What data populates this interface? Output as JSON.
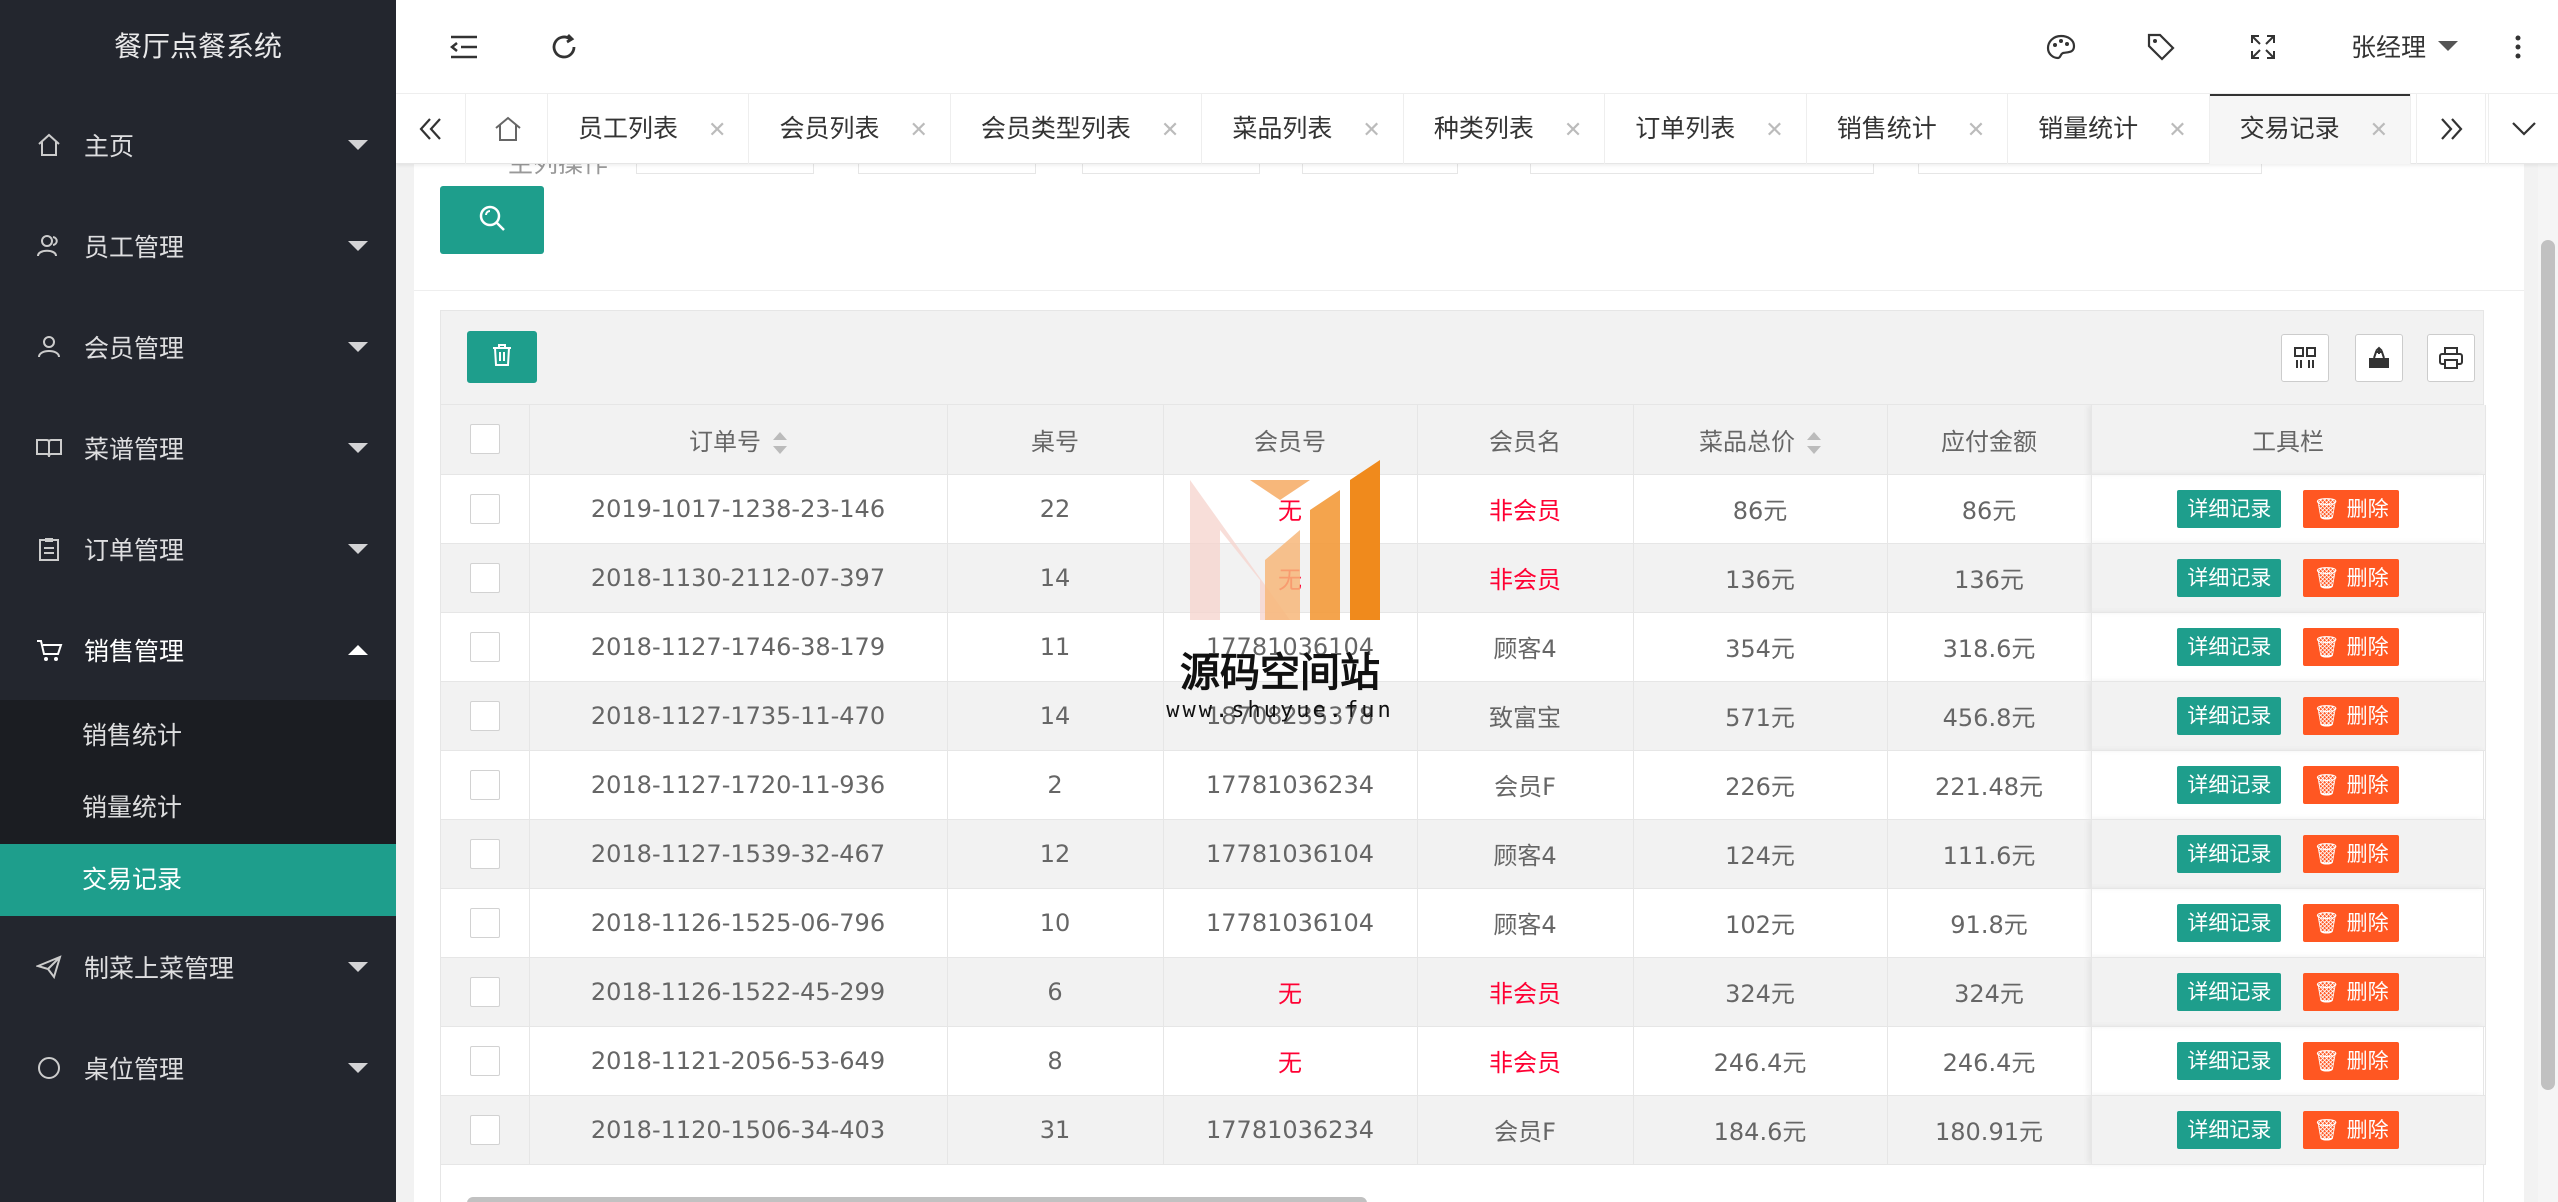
{
  "app_title": "餐厅点餐系统",
  "sidebar": {
    "items": [
      {
        "label": "主页",
        "icon": "home-icon"
      },
      {
        "label": "员工管理",
        "icon": "user-group-icon"
      },
      {
        "label": "会员管理",
        "icon": "user-icon"
      },
      {
        "label": "菜谱管理",
        "icon": "book-icon"
      },
      {
        "label": "订单管理",
        "icon": "clipboard-icon"
      },
      {
        "label": "销售管理",
        "icon": "cart-icon"
      },
      {
        "label": "制菜上菜管理",
        "icon": "send-icon"
      },
      {
        "label": "桌位管理",
        "icon": "circle-icon"
      }
    ],
    "sub_items": [
      "销售统计",
      "销量统计",
      "交易记录"
    ],
    "active_sub": "交易记录"
  },
  "header": {
    "user": "张经理"
  },
  "tabs": [
    "员工列表",
    "会员列表",
    "会员类型列表",
    "菜品列表",
    "种类列表",
    "订单列表",
    "销售统计",
    "销量统计",
    "交易记录"
  ],
  "active_tab": "交易记录",
  "filter_label": "主列操作",
  "table": {
    "columns": [
      "订单号",
      "桌号",
      "会员号",
      "会员名",
      "菜品总价",
      "应付金额",
      "工具栏"
    ],
    "detail_label": "详细记录",
    "delete_label": "删除",
    "rows": [
      {
        "order": "2019-1017-1238-23-146",
        "table": "22",
        "member_no": "无",
        "member_name": "非会员",
        "total": "86元",
        "pay": "86元"
      },
      {
        "order": "2018-1130-2112-07-397",
        "table": "14",
        "member_no": "无",
        "member_name": "非会员",
        "total": "136元",
        "pay": "136元"
      },
      {
        "order": "2018-1127-1746-38-179",
        "table": "11",
        "member_no": "17781036104",
        "member_name": "顾客4",
        "total": "354元",
        "pay": "318.6元"
      },
      {
        "order": "2018-1127-1735-11-470",
        "table": "14",
        "member_no": "18708235378",
        "member_name": "致富宝",
        "total": "571元",
        "pay": "456.8元"
      },
      {
        "order": "2018-1127-1720-11-936",
        "table": "2",
        "member_no": "17781036234",
        "member_name": "会员F",
        "total": "226元",
        "pay": "221.48元"
      },
      {
        "order": "2018-1127-1539-32-467",
        "table": "12",
        "member_no": "17781036104",
        "member_name": "顾客4",
        "total": "124元",
        "pay": "111.6元"
      },
      {
        "order": "2018-1126-1525-06-796",
        "table": "10",
        "member_no": "17781036104",
        "member_name": "顾客4",
        "total": "102元",
        "pay": "91.8元"
      },
      {
        "order": "2018-1126-1522-45-299",
        "table": "6",
        "member_no": "无",
        "member_name": "非会员",
        "total": "324元",
        "pay": "324元"
      },
      {
        "order": "2018-1121-2056-53-649",
        "table": "8",
        "member_no": "无",
        "member_name": "非会员",
        "total": "246.4元",
        "pay": "246.4元"
      },
      {
        "order": "2018-1120-1506-34-403",
        "table": "31",
        "member_no": "17781036234",
        "member_name": "会员F",
        "total": "184.6元",
        "pay": "180.91元"
      }
    ]
  },
  "watermark": {
    "title": "源码空间站",
    "url": "www.shuyue.fun"
  },
  "colors": {
    "accent": "#1e9e8c",
    "danger": "#ff5722",
    "sidebar_bg": "#23262e",
    "red_text": "#ff0033"
  }
}
